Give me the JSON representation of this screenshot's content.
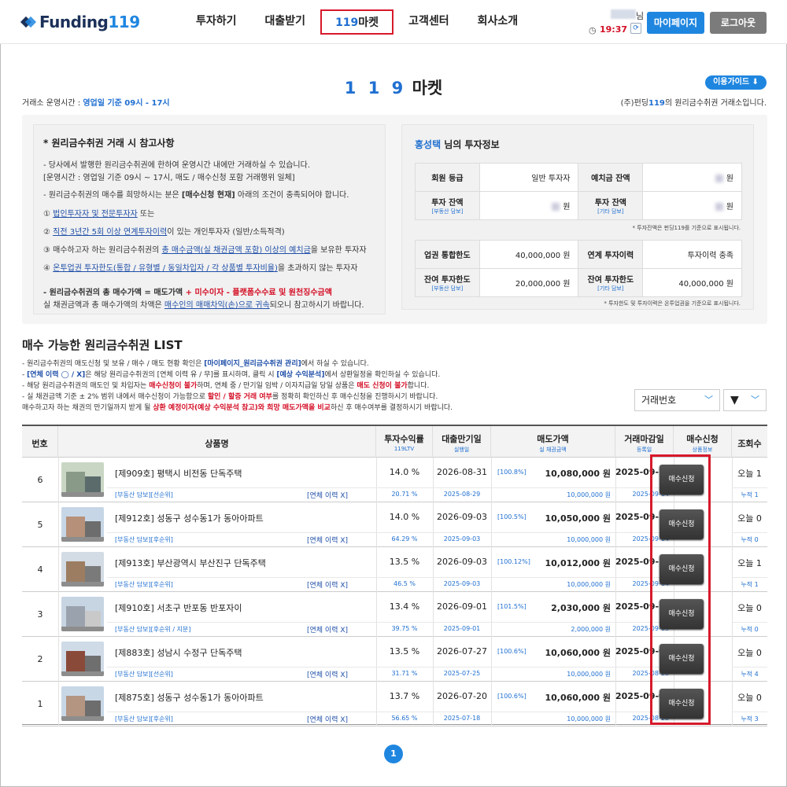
{
  "header": {
    "logo_text": "Funding",
    "logo_num": "119",
    "nav": [
      "투자하기",
      "대출받기",
      "119마켓",
      "고객센터",
      "회사소개"
    ],
    "active_nav_num": "119",
    "active_nav_text": "마켓",
    "user_suffix": "님",
    "timer": "19:37",
    "mypage_label": "마이페이지",
    "logout_label": "로그아웃"
  },
  "page": {
    "title_num": "1 1 9",
    "title_text": "마켓",
    "guide_label": "이용가이드 ⬇",
    "hours_label": "거래소 운영시간 : ",
    "hours_value": "영업일 기준 09시 - 17시",
    "owner_pre": "(주)펀딩",
    "owner_num": "119",
    "owner_post": "의 원리금수취권 거래소입니다."
  },
  "notice": {
    "title": "* 원리금수취권 거래 시 참고사항",
    "l1": "- 당사에서 발행한 원리금수취권에 한하여 운영시간 내에만 거래하실 수 있습니다.",
    "l2": "[운영시간 : 영업일 기준 09시 ~ 17시, 매도 / 매수신청 포함 거래행위 일체]",
    "l3a": "- 원리금수취권의 매수를 희망하시는 분은 ",
    "l3b": "[매수신청 현재]",
    "l3c": " 아래의 조건이 충족되어야 합니다.",
    "c1a": "① ",
    "c1b": "법인투자자 및 전문투자자",
    "c1c": " 또는",
    "c2a": "② ",
    "c2b": "직전 3년간 5회 이상 연계투자이력",
    "c2c": "이 있는 개인투자자 (일반/소득적격)",
    "c3a": "③ 매수하고자 하는 원리금수취권의 ",
    "c3b": "총 매수금액(실 채권금액 포함) 이상의 예치금",
    "c3c": "을 보유한 투자자",
    "c4a": "④ ",
    "c4b": "온투업권 투자한도(통합 / 유형별 / 동일차입자 / 각 상품별 투자비율)",
    "c4c": "을 초과하지 않는 투자자",
    "s1a": "- 원리금수취권의 총 매수가액 = 매도가액",
    "s1b": " + 미수이자 - 플랫폼수수료 및 원천징수금액",
    "s2a": "  실 채권금액과 총 매수가액의 차액은 ",
    "s2b": "매수인의 매매차익(손)으로 귀속",
    "s2c": "되오니 참고하시기 바랍니다."
  },
  "investor": {
    "name": "홍성택",
    "title_suffix": " 님의 투자정보",
    "grade_label": "회원 등급",
    "grade_value": "일반 투자자",
    "deposit_label": "예치금 잔액",
    "deposit_unit": "원",
    "bal1_label": "투자 잔액",
    "bal1_sub": "[부동산 담보]",
    "bal1_unit": "원",
    "bal2_label": "투자 잔액",
    "bal2_sub": "[기타 담보]",
    "bal2_unit": "원",
    "note1": "* 투자잔액은 펀딩119를 기준으로 표시됩니다.",
    "limit_label": "업권 통합한도",
    "limit_value": "40,000,000 원",
    "hist_label": "연계 투자이력",
    "hist_value": "투자이력 충족",
    "rem1_label": "잔여 투자한도",
    "rem1_sub": "[부동산 담보]",
    "rem1_value": "20,000,000 원",
    "rem2_label": "잔여 투자한도",
    "rem2_sub": "[기타 담보]",
    "rem2_value": "40,000,000 원",
    "note2": "* 투자한도 및 투자이력은 온투업권을 기준으로 표시됩니다."
  },
  "list": {
    "title": "매수 가능한 원리금수취권 LIST",
    "d1a": "- 원리금수취권의 매도신청 및 보유 / 매수 / 매도 현황 확인은 ",
    "d1b": "[마이페이지_원리금수취권 관리]",
    "d1c": "에서 하실 수 있습니다.",
    "d2a": "- ",
    "d2b": "[연체 이력 ◯ / X]",
    "d2c": "은 해당 원리금수취권의 [연체 이력 유 / 무]를 표시하며, 클릭 시 ",
    "d2d": "[예상 수익분석]",
    "d2e": "에서 상환일정을 확인하실 수 있습니다.",
    "d3a": "- 해당 원리금수취권의 매도인 및 차입자는 ",
    "d3b": "매수신청이 불가",
    "d3c": "하며, 연체 중 / 만기일 임박 / 이자지급일 당일 상품은 ",
    "d3d": "매도 신청이 불가",
    "d3e": "합니다.",
    "d4a": "- 실 채권금액 기준 ± 2% 범위 내에서 매수신청이 가능함으로 ",
    "d4b": "할인 / 할증 거래 여부",
    "d4c": "를 정확히 확인하신 후 매수신청을 진행하시기 바랍니다.",
    "d5a": "  매수하고자 하는 채권의 만기일까지 받게 될 ",
    "d5b": "상환 예정이자(예상 수익분석 참고)와 희망 매도가액을 비교",
    "d5c": "하신 후 매수여부를 결정하시기 바랍니다.",
    "sort_label": "거래번호",
    "order_label": "▼"
  },
  "table": {
    "headers": [
      {
        "t": "번호",
        "s": ""
      },
      {
        "t": "상품명",
        "s": ""
      },
      {
        "t": "투자수익률",
        "s": "119LTV"
      },
      {
        "t": "대출만기일",
        "s": "실행일"
      },
      {
        "t": "매도가액",
        "s": "실 채권금액"
      },
      {
        "t": "거래마감일",
        "s": "등록일"
      },
      {
        "t": "매수신청",
        "s": "상품정보"
      },
      {
        "t": "조회수",
        "s": ""
      }
    ],
    "rows": [
      {
        "no": "6",
        "name": "[제909호] 평택시 비전동 단독주택",
        "tag": "[부동산 담보][선순위]",
        "overdue": "[연체 이력 X]",
        "rate": "14.0 %",
        "ltv": "20.71 %",
        "due": "2026-08-31",
        "exec": "2025-08-29",
        "pct": "[100.8%]",
        "price": "10,080,000 원",
        "bond": "10,000,000 원",
        "close": "2025-09-11",
        "reg": "2025-09-04",
        "btn": "매수신청",
        "today": "오늘 1",
        "total": "누적 1"
      },
      {
        "no": "5",
        "name": "[제912호] 성동구 성수동1가 동아아파트",
        "tag": "[부동산 담보][후순위]",
        "overdue": "[연체 이력 X]",
        "rate": "14.0 %",
        "ltv": "64.29 %",
        "due": "2026-09-03",
        "exec": "2025-09-03",
        "pct": "[100.5%]",
        "price": "10,050,000 원",
        "bond": "10,000,000 원",
        "close": "2025-09-11",
        "reg": "2025-09-04",
        "btn": "매수신청",
        "today": "오늘 0",
        "total": "누적 0"
      },
      {
        "no": "4",
        "name": "[제913호] 부산광역시 부산진구 단독주택",
        "tag": "[부동산 담보][후순위]",
        "overdue": "[연체 이력 X]",
        "rate": "13.5 %",
        "ltv": "46.5 %",
        "due": "2026-09-03",
        "exec": "2025-09-03",
        "pct": "[100.12%]",
        "price": "10,012,000 원",
        "bond": "10,000,000 원",
        "close": "2025-09-11",
        "reg": "2025-09-04",
        "btn": "매수신청",
        "today": "오늘 1",
        "total": "누적 1"
      },
      {
        "no": "3",
        "name": "[제910호] 서초구 반포동 반포자이",
        "tag": "[부동산 담보][후순위 / 지분]",
        "overdue": "[연체 이력 X]",
        "rate": "13.4 %",
        "ltv": "39.75 %",
        "due": "2026-09-01",
        "exec": "2025-09-01",
        "pct": "[101.5%]",
        "price": "2,030,000 원",
        "bond": "2,000,000 원",
        "close": "2025-09-10",
        "reg": "2025-09-03",
        "btn": "매수신청",
        "today": "오늘 0",
        "total": "누적 0"
      },
      {
        "no": "2",
        "name": "[제883호] 성남시 수정구 단독주택",
        "tag": "[부동산 담보][선순위]",
        "overdue": "[연체 이력 X]",
        "rate": "13.5 %",
        "ltv": "31.71 %",
        "due": "2026-07-27",
        "exec": "2025-07-25",
        "pct": "[100.6%]",
        "price": "10,060,000 원",
        "bond": "10,000,000 원",
        "close": "2025-09-04",
        "reg": "2025-08-28",
        "btn": "매수신청",
        "today": "오늘 0",
        "total": "누적 4"
      },
      {
        "no": "1",
        "name": "[제875호] 성동구 성수동1가 동아아파트",
        "tag": "[부동산 담보][후순위]",
        "overdue": "[연체 이력 X]",
        "rate": "13.7 %",
        "ltv": "56.65 %",
        "due": "2026-07-20",
        "exec": "2025-07-18",
        "pct": "[100.6%]",
        "price": "10,060,000 원",
        "bond": "10,000,000 원",
        "close": "2025-09-04",
        "reg": "2025-08-28",
        "btn": "매수신청",
        "today": "오늘 0",
        "total": "누적 3"
      }
    ]
  },
  "pagination": {
    "current": "1"
  }
}
